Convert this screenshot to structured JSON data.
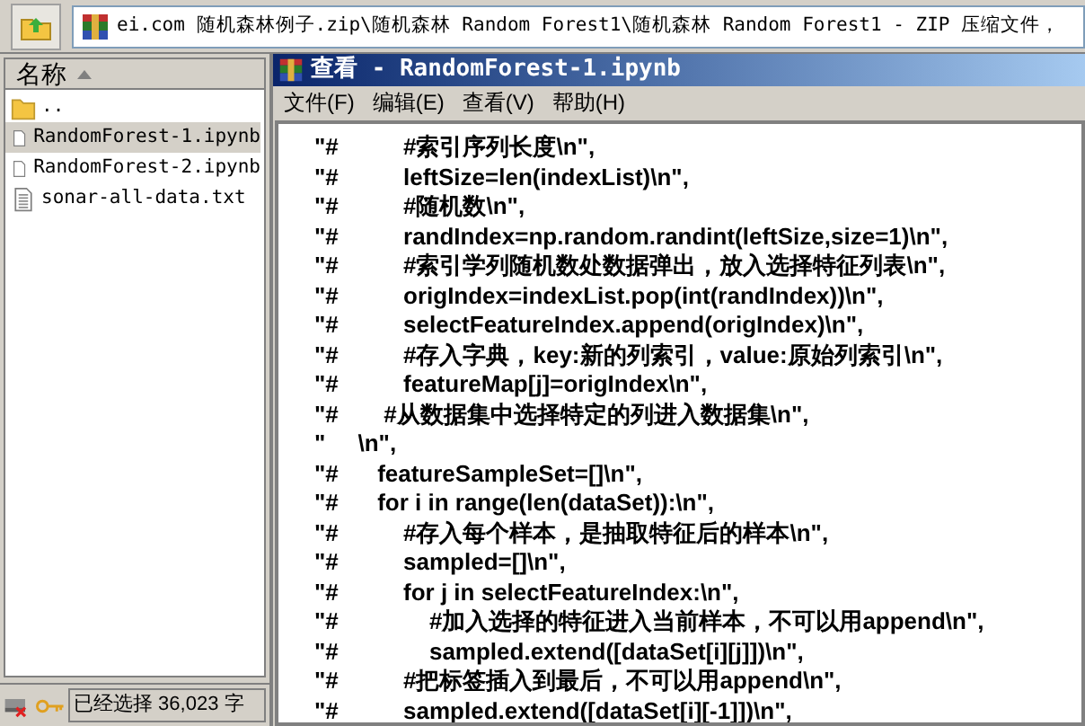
{
  "address_bar": {
    "path": "ei.com 随机森林例子.zip\\随机森林 Random Forest1\\随机森林 Random Forest1 - ZIP 压缩文件，"
  },
  "file_list": {
    "column_header": "名称",
    "items": [
      {
        "name": "..",
        "kind": "folder",
        "selected": false
      },
      {
        "name": "RandomForest-1.ipynb",
        "kind": "file",
        "selected": true
      },
      {
        "name": "RandomForest-2.ipynb",
        "kind": "file",
        "selected": false
      },
      {
        "name": "sonar-all-data.txt",
        "kind": "text",
        "selected": false
      }
    ]
  },
  "viewer": {
    "title": "查看 - RandomForest-1.ipynb",
    "menu": [
      "文件(F)",
      "编辑(E)",
      "查看(V)",
      "帮助(H)"
    ],
    "lines": [
      "\"#          #索引序列长度\\n\",",
      "\"#          leftSize=len(indexList)\\n\",",
      "\"#          #随机数\\n\",",
      "\"#          randIndex=np.random.randint(leftSize,size=1)\\n\",",
      "\"#          #索引学列随机数处数据弹出，放入选择特征列表\\n\",",
      "\"#          origIndex=indexList.pop(int(randIndex))\\n\",",
      "\"#          selectFeatureIndex.append(origIndex)\\n\",",
      "\"#          #存入字典，key:新的列索引，value:原始列索引\\n\",",
      "\"#          featureMap[j]=origIndex\\n\",",
      "\"#       #从数据集中选择特定的列进入数据集\\n\",",
      "\"     \\n\",",
      "\"#      featureSampleSet=[]\\n\",",
      "\"#      for i in range(len(dataSet)):\\n\",",
      "\"#          #存入每个样本，是抽取特征后的样本\\n\",",
      "\"#          sampled=[]\\n\",",
      "\"#          for j in selectFeatureIndex:\\n\",",
      "\"#              #加入选择的特征进入当前样本，不可以用append\\n\",",
      "\"#              sampled.extend([dataSet[i][j]])\\n\",",
      "\"#          #把标签插入到最后，不可以用append\\n\",",
      "\"#          sampled.extend([dataSet[i][-1]])\\n\","
    ]
  },
  "status_bar": {
    "text": "已经选择 36,023 字"
  }
}
